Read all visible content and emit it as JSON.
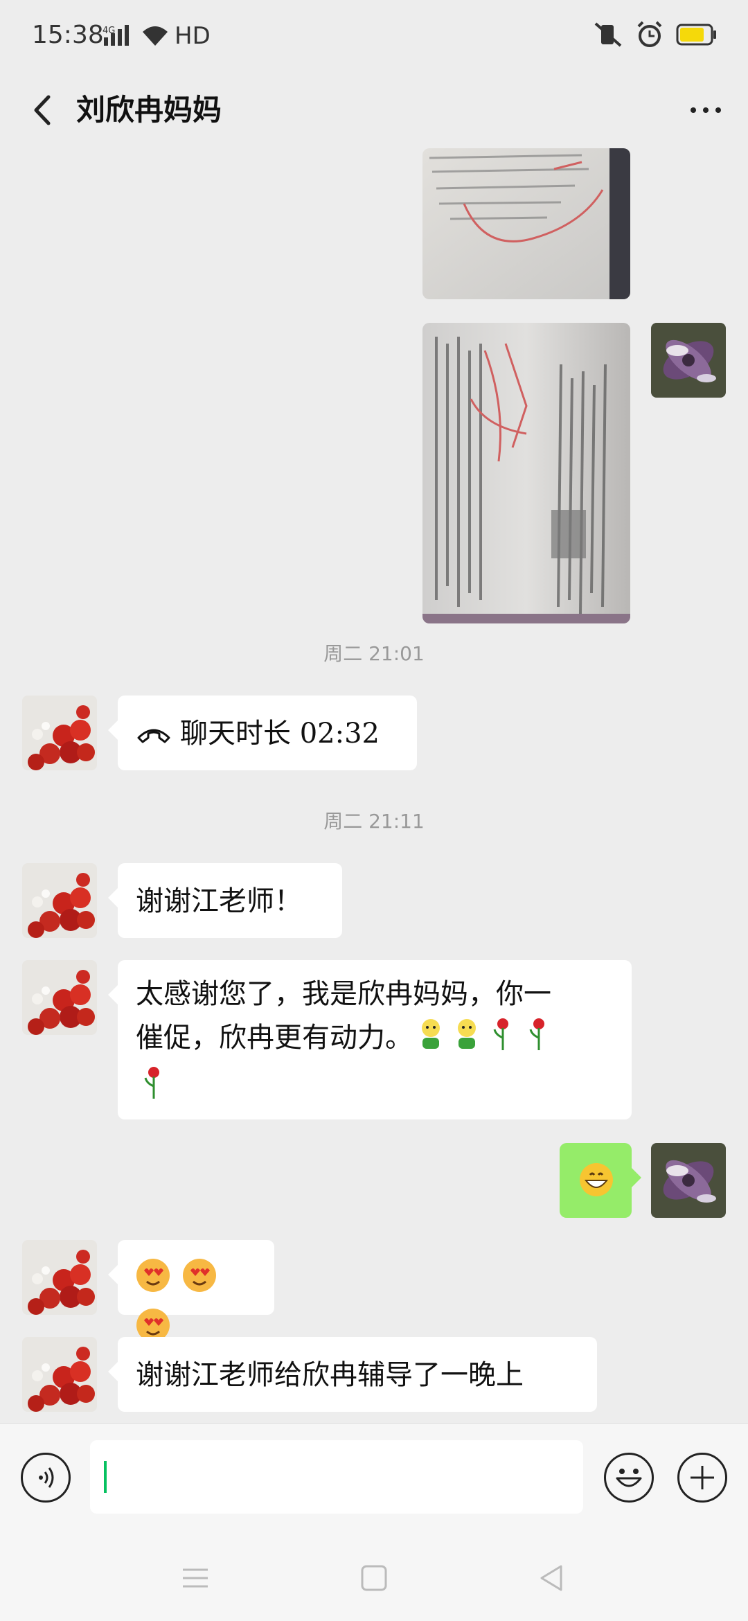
{
  "status_bar": {
    "time": "15:38",
    "network": "4G",
    "hd": "HD"
  },
  "header": {
    "title": "刘欣冉妈妈"
  },
  "timestamps": [
    "周二 21:01",
    "周二 21:11"
  ],
  "messages": {
    "call": {
      "label": "聊天时长 02:32"
    },
    "thanks": {
      "text": "谢谢江老师！"
    },
    "long": {
      "line1": "太感谢您了，我是欣冉妈妈，你一",
      "line2": "催促，欣冉更有动力。"
    },
    "last": {
      "text": "谢谢江老师给欣冉辅导了一晚上"
    }
  },
  "icons": {
    "back": "chevron-left-icon",
    "more": "more-dots-icon",
    "phone": "phone-call-icon",
    "voice": "voice-icon",
    "emoji": "smiley-icon",
    "plus": "plus-icon",
    "nav_menu": "menu-icon",
    "nav_home": "home-icon",
    "nav_back": "back-triangle-icon"
  },
  "colors": {
    "background": "#ededed",
    "sent_bubble": "#95ec69",
    "cursor": "#07c160"
  }
}
